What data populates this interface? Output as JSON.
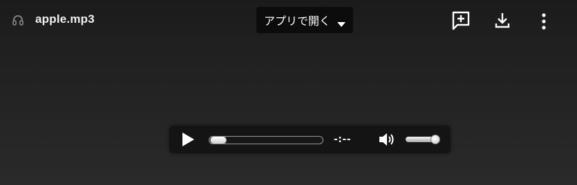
{
  "file": {
    "name": "apple.mp3",
    "icon": "headphones-icon"
  },
  "header": {
    "open_with_label": "アプリで開く",
    "open_with_caret_icon": "caret-down-icon",
    "comment_icon": "add-comment-icon",
    "download_icon": "download-icon",
    "more_icon": "more-vert-icon"
  },
  "player": {
    "play_icon": "play-icon",
    "time": "-:--",
    "progress": 0,
    "volume_icon": "volume-up-icon",
    "volume": 1.0
  },
  "colors": {
    "background": "#262626",
    "topbar_text": "#f1f1f1",
    "button_bg": "#0c0c0c",
    "player_bg": "#141414"
  }
}
